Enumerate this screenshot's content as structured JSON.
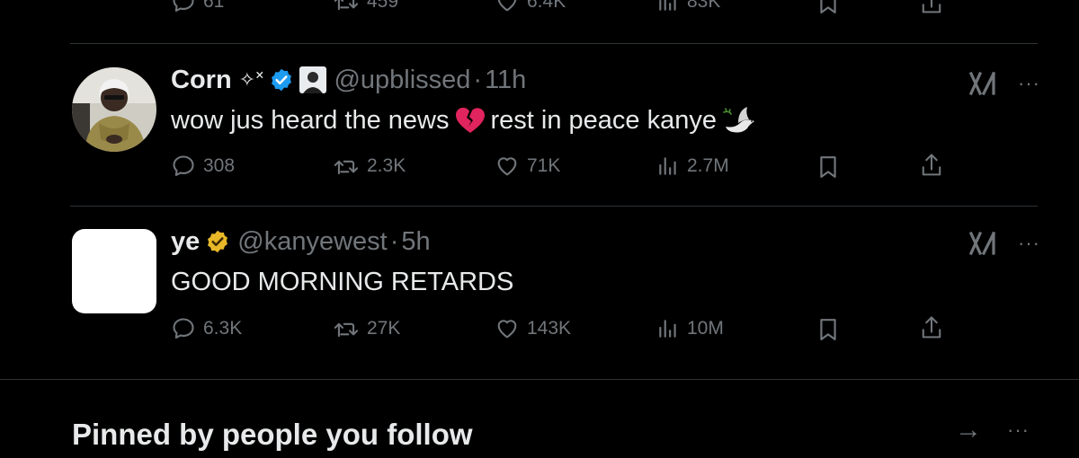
{
  "prev_tweet": {
    "actions": {
      "replies": "61",
      "retweets": "459",
      "likes": "6.4K",
      "views": "83K"
    }
  },
  "tweets": [
    {
      "display_name": "Corn",
      "name_symbols": "✧˟",
      "handle": "@upblissed",
      "separator": "·",
      "time": "11h",
      "text_part1": "wow jus heard the news",
      "text_part2": "rest in peace kanye",
      "verified_color": "#1d9bf0",
      "actions": {
        "replies": "308",
        "retweets": "2.3K",
        "likes": "71K",
        "views": "2.7M"
      }
    },
    {
      "display_name": "ye",
      "handle": "@kanyewest",
      "separator": "·",
      "time": "5h",
      "text": "GOOD MORNING RETARDS",
      "verified_color": "#e8b829",
      "actions": {
        "replies": "6.3K",
        "retweets": "27K",
        "likes": "143K",
        "views": "10M"
      }
    }
  ],
  "section": {
    "title": "Pinned by people you follow"
  },
  "icons": {
    "reply": "speech-bubble-icon",
    "retweet": "retweet-icon",
    "like": "heart-icon",
    "views": "bar-chart-icon",
    "bookmark": "bookmark-icon",
    "share": "share-icon",
    "grok": "grok-icon",
    "more": "more-icon",
    "arrow": "arrow-right-icon"
  },
  "more_glyph": "···",
  "arrow_glyph": "→",
  "colors": {
    "background": "#000000",
    "text": "#e7e9ea",
    "muted": "#71767b",
    "divider": "#2f3336",
    "broken_heart": "#e0245e"
  }
}
